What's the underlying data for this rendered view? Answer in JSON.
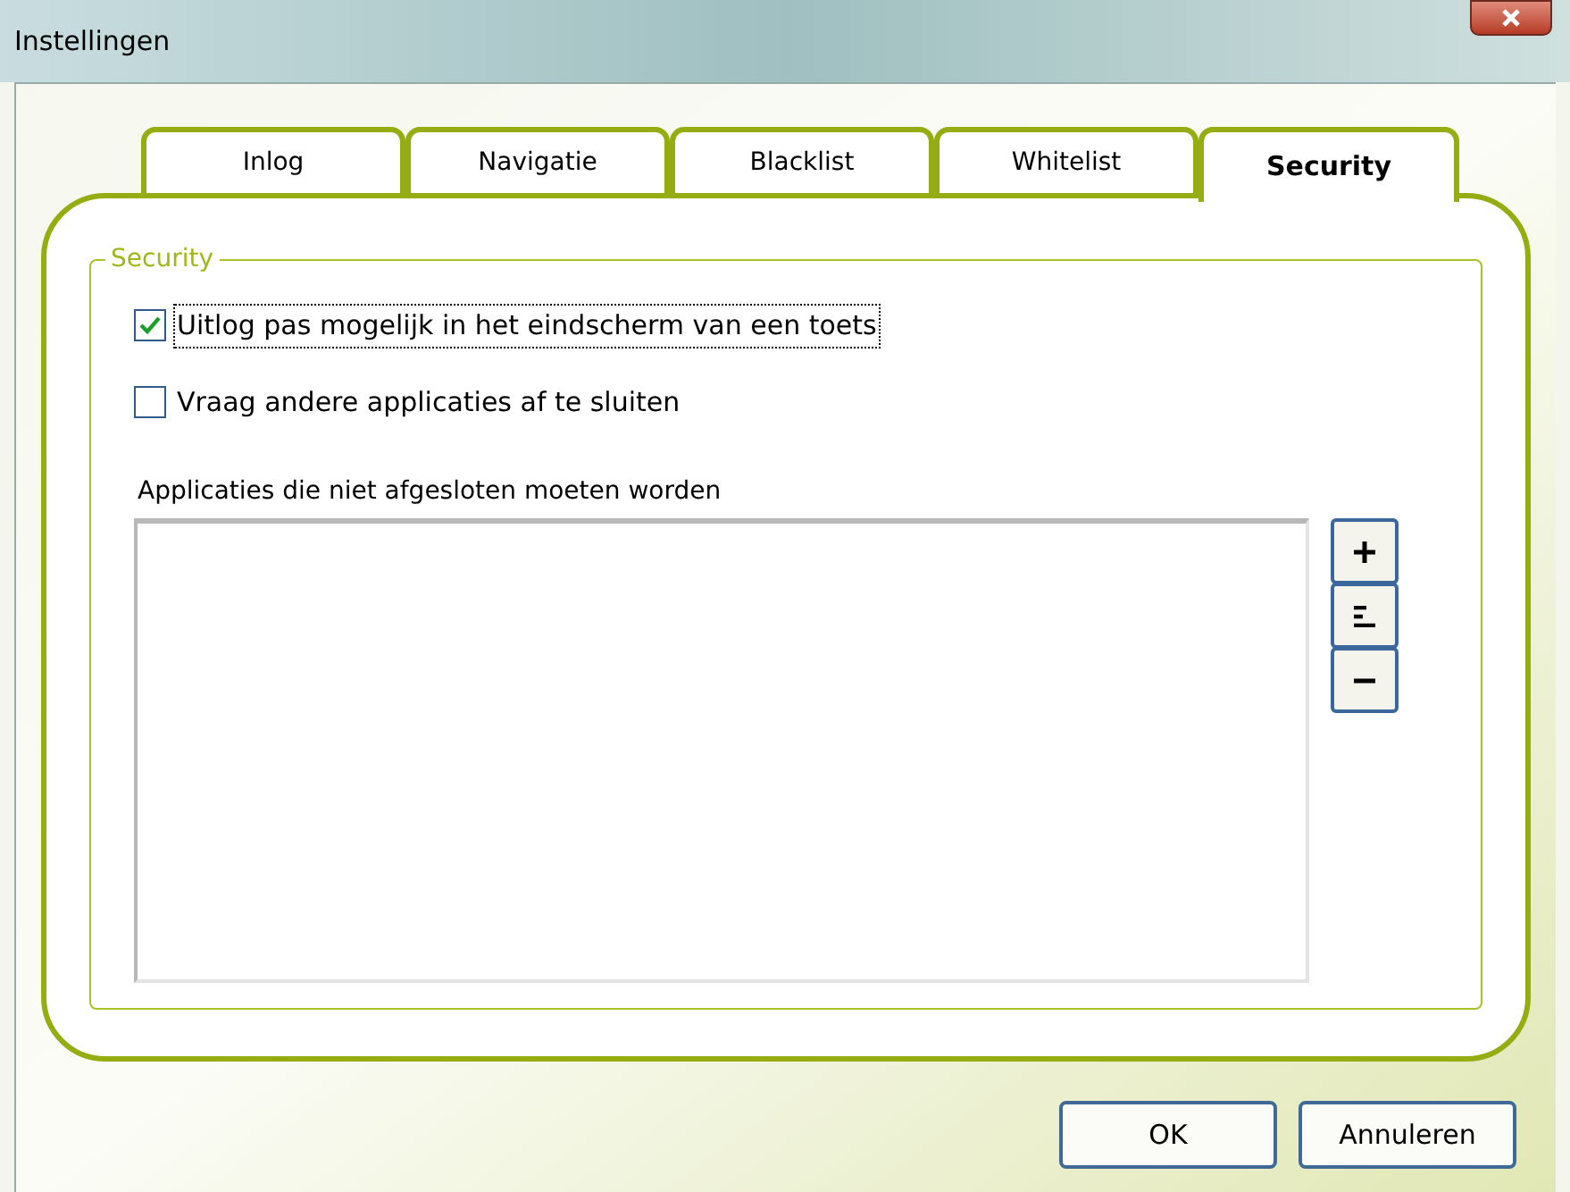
{
  "window": {
    "title": "Instellingen"
  },
  "tabs": [
    {
      "label": "Inlog",
      "selected": false
    },
    {
      "label": "Navigatie",
      "selected": false
    },
    {
      "label": "Blacklist",
      "selected": false
    },
    {
      "label": "Whitelist",
      "selected": false
    },
    {
      "label": "Security",
      "selected": true
    }
  ],
  "group": {
    "title": "Security",
    "checkboxes": [
      {
        "label": "Uitlog pas mogelijk in het eindscherm van een toets",
        "checked": true,
        "focused": true
      },
      {
        "label": "Vraag andere applicaties af te sluiten",
        "checked": false,
        "focused": false
      }
    ],
    "list_label": "Applicaties die niet afgesloten moeten worden",
    "list_buttons": [
      {
        "kind": "add"
      },
      {
        "kind": "edit"
      },
      {
        "kind": "remove"
      }
    ]
  },
  "buttons": [
    "OK",
    "Annuleren"
  ]
}
